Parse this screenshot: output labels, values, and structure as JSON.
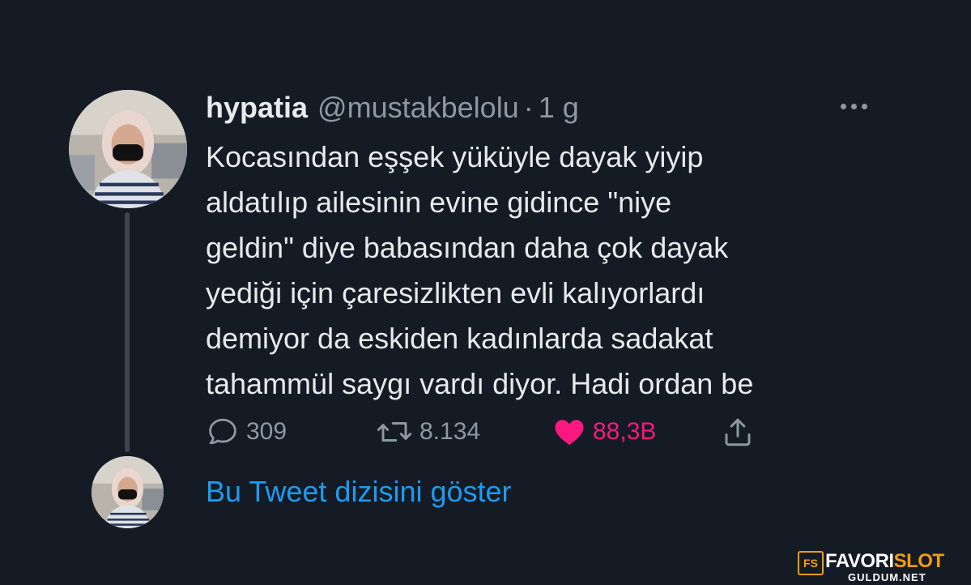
{
  "tweet": {
    "display_name": "hypatia",
    "handle": "@mustakbelolu",
    "separator": "·",
    "time": "1 g",
    "text_lines": [
      "Kocasından eşşek yüküyle dayak yiyip",
      "aldatılıp ailesinin evine gidince \"niye",
      "geldin\" diye babasından daha çok dayak",
      "yediği için çaresizlikten evli kalıyorlardı",
      "demiyor da eskiden kadınlarda sadakat",
      "tahammül saygı vardı diyor. Hadi ordan be"
    ],
    "reply_count": "309",
    "retweet_count": "8.134",
    "like_count": "88,3B",
    "liked": true
  },
  "icons": {
    "more": "more-horizontal-icon",
    "reply": "reply-bubble-icon",
    "retweet": "retweet-arrows-icon",
    "like": "heart-icon",
    "share": "share-upload-icon"
  },
  "thread": {
    "show_label": "Bu Tweet dizisini göster"
  },
  "watermark": {
    "badge": "FS",
    "brand_part1": "FAVORI",
    "brand_part2": "SLOT",
    "sub": "GULDUM.NET"
  },
  "colors": {
    "background": "#151b24",
    "text": "#e7e9ea",
    "muted": "#8b98a5",
    "link": "#1d9bf0",
    "like": "#f91880",
    "watermark_accent": "#f39c12"
  }
}
